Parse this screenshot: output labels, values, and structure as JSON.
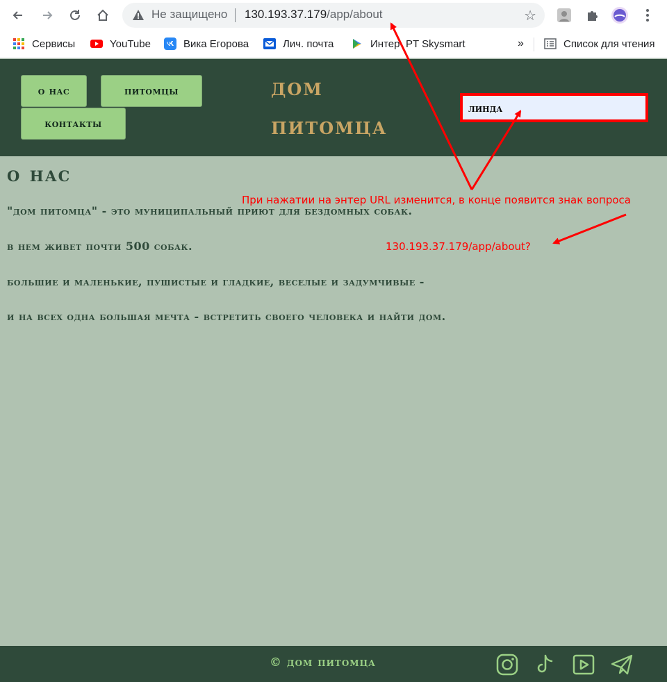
{
  "browser": {
    "status_label": "Не защищено",
    "url_host": "130.193.37.179",
    "url_path": "/app/about",
    "bookmarks": [
      {
        "label": "Сервисы",
        "icon": "apps-grid-icon"
      },
      {
        "label": "YouTube",
        "icon": "youtube-icon"
      },
      {
        "label": "Вика Егорова",
        "icon": "vk-icon"
      },
      {
        "label": "Лич. почта",
        "icon": "mail-icon"
      },
      {
        "label": "Интер",
        "icon": "play-store-icon"
      },
      {
        "label": "PT Skysmart",
        "icon": "skysmart-icon"
      }
    ],
    "overflow": "»",
    "reading_list": "Список для чтения"
  },
  "header": {
    "nav": [
      {
        "label": "о нас"
      },
      {
        "label": "питомцы"
      },
      {
        "label": "контакты"
      }
    ],
    "brand_line1": "дом",
    "brand_line2": "питомца",
    "search_value": "линда"
  },
  "main": {
    "title": "о нас",
    "paragraphs": [
      "\"дом питомца\" - это муниципальный приют для бездомных собак.",
      "в нем живет почти 500 собак.",
      "большие и маленькие, пушистые и гладкие, веселые и задумчивые -",
      "и на всех одна большая мечта - встретить своего человека и найти дом."
    ]
  },
  "annotations": {
    "note": "При нажатии на энтер URL изменится, в конце появится знак вопроса",
    "url_result": "130.193.37.179/app/about?",
    "color": "#ff0000"
  },
  "footer": {
    "copyright": "© дом питомца",
    "social_icons": [
      "instagram-icon",
      "tiktok-icon",
      "youtube-play-icon",
      "telegram-icon"
    ]
  },
  "colors": {
    "header_bg": "#2f4a3a",
    "page_bg": "#b0c2b1",
    "accent_green": "#9bd085",
    "brand_gold": "#c9a564"
  }
}
